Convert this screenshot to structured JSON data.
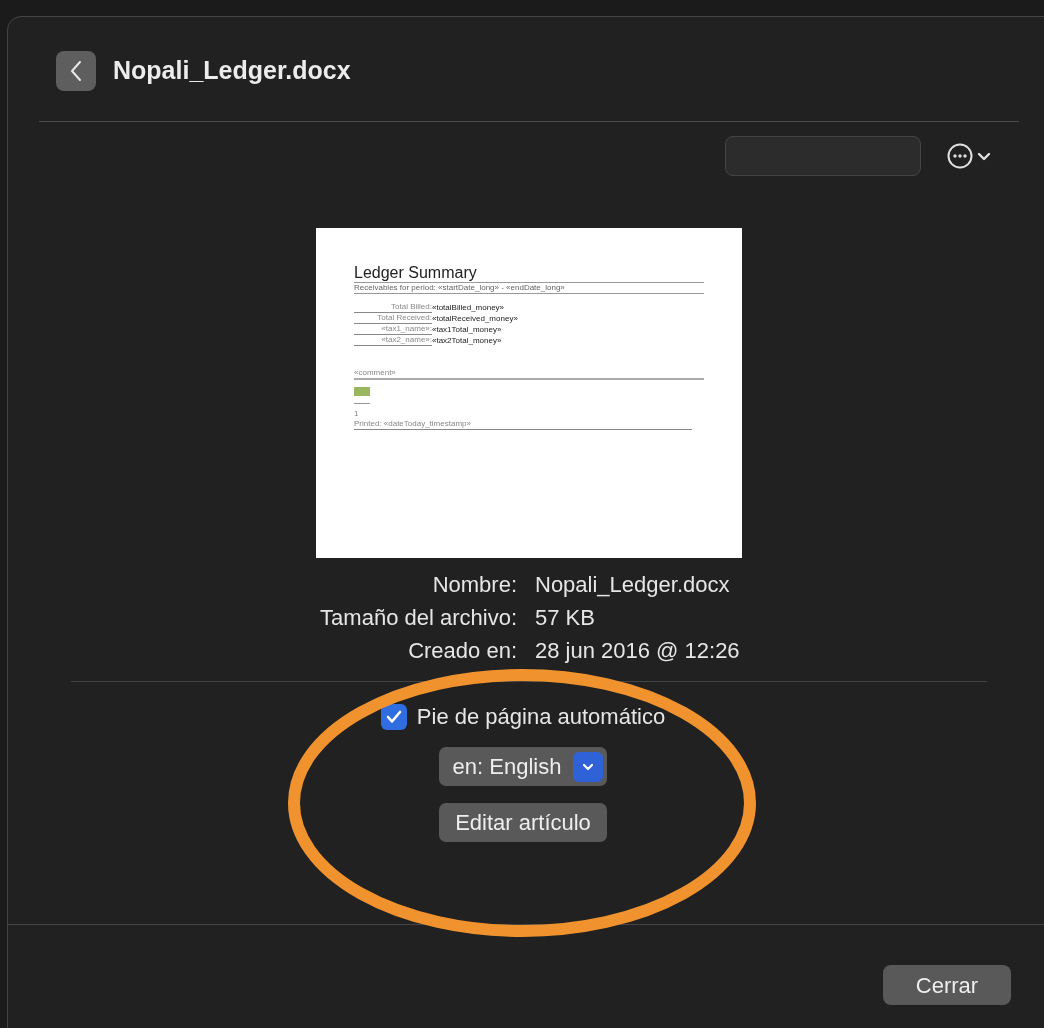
{
  "window": {
    "title": "Nopali_Ledger.docx"
  },
  "preview": {
    "title": "Ledger Summary",
    "subtitle": "Receivables for period: «startDate_long» - «endDate_long»",
    "rows": [
      {
        "label": "Total Billed:",
        "value": "«totalBilled_money»"
      },
      {
        "label": "Total Received:",
        "value": "«totalReceived_money»"
      },
      {
        "label": "«tax1_name»:",
        "value": "«tax1Total_money»"
      },
      {
        "label": "«tax2_name»:",
        "value": "«tax2Total_money»"
      }
    ],
    "comment": "«comment»",
    "page_number": "1",
    "printed": "Printed: «dateToday_timestamp»"
  },
  "info": [
    {
      "label": "Nombre:",
      "value": "Nopali_Ledger.docx"
    },
    {
      "label": "Tamaño del archivo:",
      "value": "57 KB"
    },
    {
      "label": "Creado en:",
      "value": "28 jun 2016 @ 12:26"
    }
  ],
  "auto_footer": {
    "label": "Pie de página automático",
    "checked": true
  },
  "language": {
    "value": "en: English"
  },
  "edit_button": "Editar artículo",
  "close_button": "Cerrar"
}
